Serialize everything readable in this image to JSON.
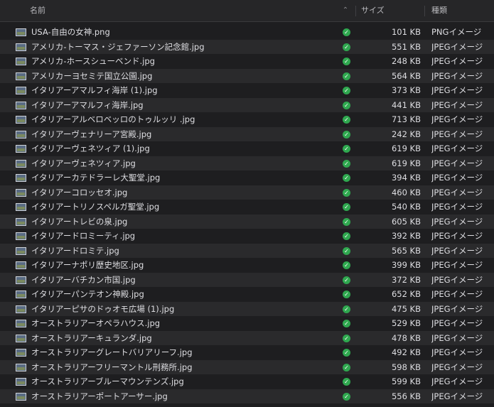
{
  "header": {
    "name_label": "名前",
    "sort_icon": "chevron-up-icon",
    "size_label": "サイズ",
    "kind_label": "種類"
  },
  "colors": {
    "background": "#1e1e20",
    "row_alt": "#2a2a2c",
    "status_synced": "#2fa84f",
    "text": "#dedee2"
  },
  "files": [
    {
      "name": "USA-自由の女神.png",
      "size": "101 KB",
      "kind": "PNGイメージ"
    },
    {
      "name": "アメリカ-トーマス・ジェファーソン記念館.jpg",
      "size": "551 KB",
      "kind": "JPEGイメージ"
    },
    {
      "name": "アメリカ-ホースシューベンド.jpg",
      "size": "248 KB",
      "kind": "JPEGイメージ"
    },
    {
      "name": "アメリカーヨセミテ国立公園.jpg",
      "size": "564 KB",
      "kind": "JPEGイメージ"
    },
    {
      "name": "イタリアーアマルフィ海岸 (1).jpg",
      "size": "373 KB",
      "kind": "JPEGイメージ"
    },
    {
      "name": "イタリアーアマルフィ海岸.jpg",
      "size": "441 KB",
      "kind": "JPEGイメージ"
    },
    {
      "name": "イタリアーアルベロベッロのトゥルッリ .jpg",
      "size": "713 KB",
      "kind": "JPEGイメージ"
    },
    {
      "name": "イタリアーヴェナリーア宮殿.jpg",
      "size": "242 KB",
      "kind": "JPEGイメージ"
    },
    {
      "name": "イタリアーヴェネツィア (1).jpg",
      "size": "619 KB",
      "kind": "JPEGイメージ"
    },
    {
      "name": "イタリアーヴェネツィア.jpg",
      "size": "619 KB",
      "kind": "JPEGイメージ"
    },
    {
      "name": "イタリアーカテドラーレ大聖堂.jpg",
      "size": "394 KB",
      "kind": "JPEGイメージ"
    },
    {
      "name": "イタリアーコロッセオ.jpg",
      "size": "460 KB",
      "kind": "JPEGイメージ"
    },
    {
      "name": "イタリアートリノスペルガ聖堂.jpg",
      "size": "540 KB",
      "kind": "JPEGイメージ"
    },
    {
      "name": "イタリアートレビの泉.jpg",
      "size": "605 KB",
      "kind": "JPEGイメージ"
    },
    {
      "name": "イタリアードロミーティ.jpg",
      "size": "392 KB",
      "kind": "JPEGイメージ"
    },
    {
      "name": "イタリアードロミテ.jpg",
      "size": "565 KB",
      "kind": "JPEGイメージ"
    },
    {
      "name": "イタリアーナポリ歴史地区.jpg",
      "size": "399 KB",
      "kind": "JPEGイメージ"
    },
    {
      "name": "イタリアーバチカン市国.jpg",
      "size": "372 KB",
      "kind": "JPEGイメージ"
    },
    {
      "name": "イタリアーパンテオン神殿.jpg",
      "size": "652 KB",
      "kind": "JPEGイメージ"
    },
    {
      "name": "イタリアーピサのドゥオモ広場 (1).jpg",
      "size": "475 KB",
      "kind": "JPEGイメージ"
    },
    {
      "name": "オーストラリアーオペラハウス.jpg",
      "size": "529 KB",
      "kind": "JPEGイメージ"
    },
    {
      "name": "オーストラリアーキュランダ.jpg",
      "size": "478 KB",
      "kind": "JPEGイメージ"
    },
    {
      "name": "オーストラリアーグレートバリアリーフ.jpg",
      "size": "492 KB",
      "kind": "JPEGイメージ"
    },
    {
      "name": "オーストラリアーフリーマントル刑務所.jpg",
      "size": "598 KB",
      "kind": "JPEGイメージ"
    },
    {
      "name": "オーストラリアーブルーマウンテンズ.jpg",
      "size": "599 KB",
      "kind": "JPEGイメージ"
    },
    {
      "name": "オーストラリアーポートアーサー.jpg",
      "size": "556 KB",
      "kind": "JPEGイメージ"
    }
  ]
}
